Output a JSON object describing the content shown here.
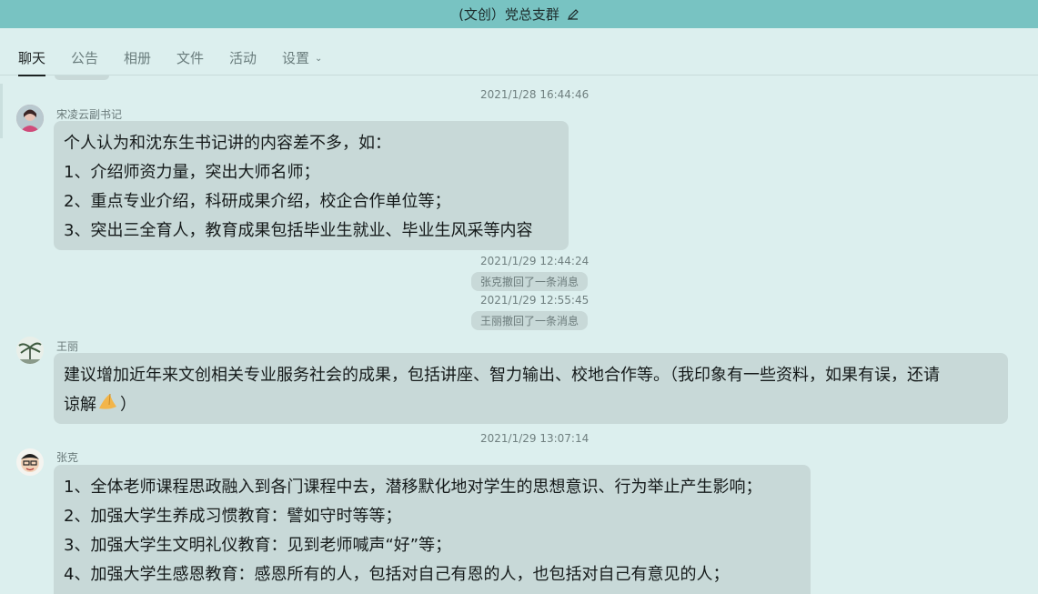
{
  "window": {
    "title": "(文创）党总支群"
  },
  "tabs": [
    {
      "label": "聊天",
      "active": true
    },
    {
      "label": "公告"
    },
    {
      "label": "相册"
    },
    {
      "label": "文件"
    },
    {
      "label": "活动"
    },
    {
      "label": "设置"
    }
  ],
  "messages": {
    "m1": {
      "time": "2021/1/28 16:44:46",
      "sender": "宋凌云副书记",
      "lines": [
        "个人认为和沈东生书记讲的内容差不多，如：",
        "1、介绍师资力量，突出大师名师；",
        "2、重点专业介绍，科研成果介绍，校企合作单位等；",
        "3、突出三全育人，教育成果包括毕业生就业、毕业生风采等内容"
      ]
    },
    "n1": {
      "time": "2021/1/29 12:44:24",
      "text": "张克撤回了一条消息"
    },
    "n2": {
      "time": "2021/1/29 12:55:45",
      "text": "王丽撤回了一条消息"
    },
    "m2": {
      "sender": "王丽",
      "line1": "建议增加近年来文创相关专业服务社会的成果，包括讲座、智力输出、校地合作等。（我印象有一些资料，如果有误，还请",
      "line2a": "谅解",
      "emoji": "pray-emoji",
      "line2b": "）"
    },
    "m3": {
      "time": "2021/1/29 13:07:14",
      "sender": "张克",
      "lines": [
        "1、全体老师课程思政融入到各门课程中去，潜移默化地对学生的思想意识、行为举止产生影响；",
        "2、加强大学生养成习惯教育：譬如守时等等；",
        "3、加强大学生文明礼仪教育：见到老师喊声“好”等；",
        "4、加强大学生感恩教育：感恩所有的人，包括对自己有恩的人，也包括对自己有意见的人；"
      ]
    }
  },
  "colors": {
    "titlebar": "#78c3c2",
    "background": "#dcefee",
    "bubble": "#c8d9d8"
  }
}
